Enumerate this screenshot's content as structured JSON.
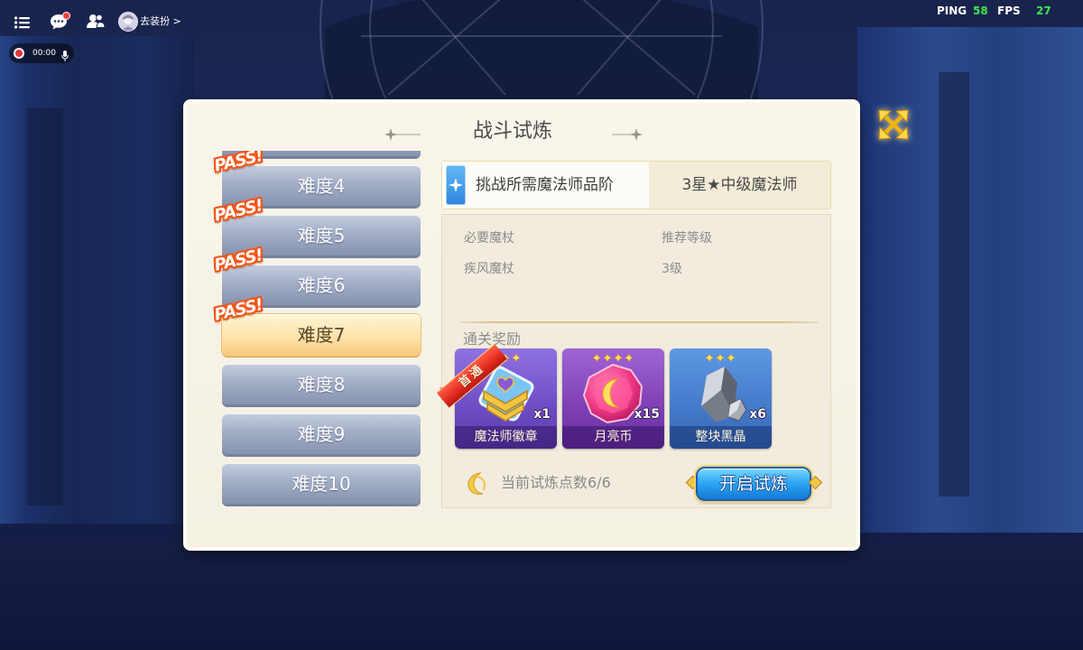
{
  "hud": {
    "menu_icon": "menu-list-icon",
    "chat_icon": "chat-bubble-icon",
    "friends_icon": "friends-icon",
    "dress_up_label": "去装扮 >",
    "record_time": "00:00",
    "ping_label": "PING",
    "ping_value": "58",
    "fps_label": "FPS",
    "fps_value": "27",
    "stat_value_color": "#3ee44e",
    "notification_dot_color": "#ff3b3b"
  },
  "dialog": {
    "title": "战斗试炼",
    "close_icon": "close-arrows-icon",
    "pass_stamp": "PASS!",
    "difficulties": [
      {
        "label": "难度4",
        "passed": true,
        "selected": false
      },
      {
        "label": "难度5",
        "passed": true,
        "selected": false
      },
      {
        "label": "难度6",
        "passed": true,
        "selected": false
      },
      {
        "label": "难度7",
        "passed": true,
        "selected": true
      },
      {
        "label": "难度8",
        "passed": false,
        "selected": false
      },
      {
        "label": "难度9",
        "passed": false,
        "selected": false
      },
      {
        "label": "难度10",
        "passed": false,
        "selected": false
      }
    ],
    "requirement": {
      "label": "挑战所需魔法师品阶",
      "value": "3星★中级魔法师"
    },
    "info": {
      "wand_header": "必要魔杖",
      "level_header": "推荐等级",
      "wand_value": "疾风魔杖",
      "level_value": "3级"
    },
    "rewards_title": "通关奖励",
    "rewards": [
      {
        "name": "魔法师徽章",
        "count": "x1",
        "stars": 3,
        "icon": "mage-badge-icon",
        "first_clear_tag": "首通"
      },
      {
        "name": "月亮币",
        "count": "x15",
        "stars": 4,
        "icon": "moon-coin-icon"
      },
      {
        "name": "整块黑晶",
        "count": "x6",
        "stars": 3,
        "icon": "black-crystal-icon"
      }
    ],
    "trial_points": "当前试炼点数6/6",
    "start_button": "开启试炼",
    "colors": {
      "selected_item": "#fde2a6",
      "start_button": "#2ea8f3",
      "pass_stamp": "#f1571a"
    }
  }
}
